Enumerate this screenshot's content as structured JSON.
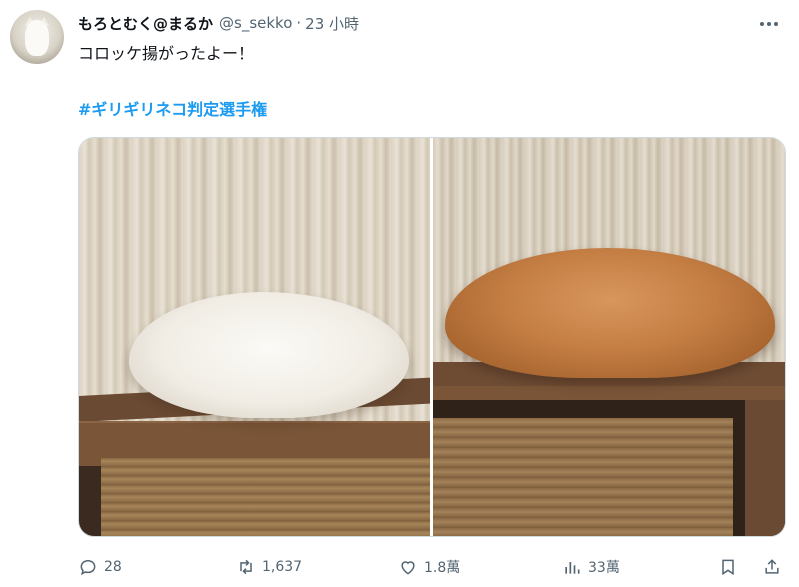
{
  "tweet": {
    "display_name": "もろとむく@まるか",
    "handle": "@s_sekko",
    "separator": "·",
    "time": "23 小時",
    "text": "コロッケ揚がったよー！",
    "hashtag": "#ギリギリネコ判定選手権"
  },
  "media": {
    "photos": [
      {
        "subject": "white-cat-loaf"
      },
      {
        "subject": "orange-cat-loaf"
      }
    ]
  },
  "actions": {
    "replies": "28",
    "retweets": "1,637",
    "likes": "1.8萬",
    "views": "33萬"
  },
  "icons": {
    "more": "more-horizontal-icon",
    "reply": "reply-icon",
    "retweet": "retweet-icon",
    "like": "heart-icon",
    "views": "views-chart-icon",
    "bookmark": "bookmark-icon",
    "share": "share-icon"
  },
  "colors": {
    "text": "#0f1419",
    "secondary": "#536471",
    "link": "#1d9bf0"
  }
}
